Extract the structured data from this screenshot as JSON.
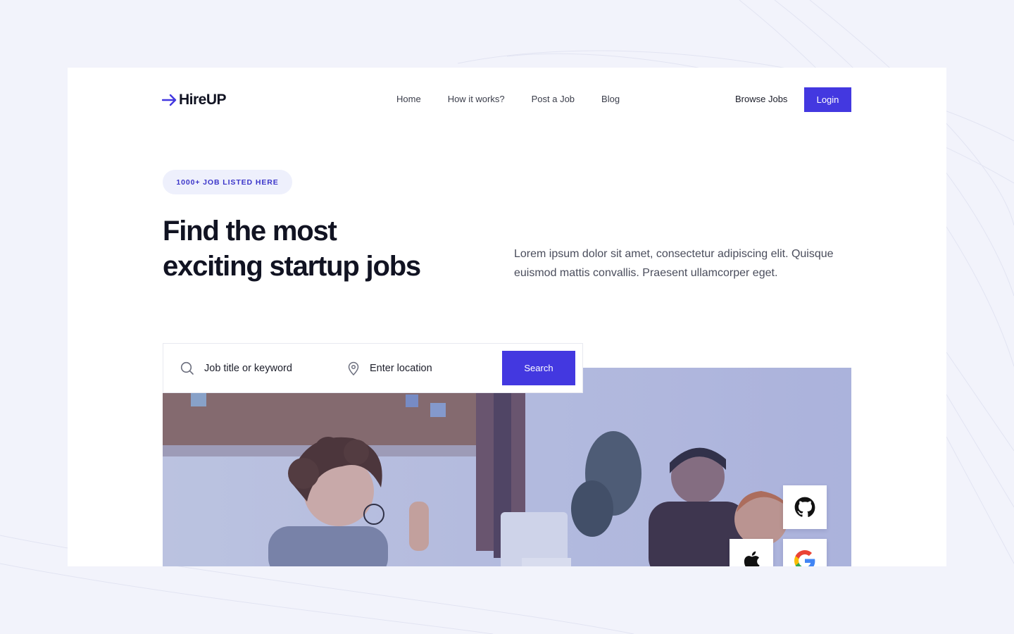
{
  "brand": {
    "name": "HireUP",
    "accent": "#4338e0"
  },
  "nav": {
    "items": [
      "Home",
      "How it works?",
      "Post a Job",
      "Blog"
    ]
  },
  "header": {
    "browse_label": "Browse Jobs",
    "login_label": "Login"
  },
  "hero": {
    "badge": "1000+ JOB LISTED HERE",
    "headline_line1": "Find the most",
    "headline_line2": "exciting startup jobs",
    "description_line1": "Lorem ipsum dolor sit amet, consectetur adipiscing elit. Quisque",
    "description_line2": "euismod mattis convallis. Praesent ullamcorper eget."
  },
  "search": {
    "keyword_placeholder": "Job title or keyword",
    "location_placeholder": "Enter location",
    "button_label": "Search"
  },
  "company_logos": [
    "github-icon",
    "apple-icon",
    "google-icon"
  ],
  "icons": {
    "search": "search-icon",
    "location": "location-pin-icon",
    "logo_arrow": "arrow-right-icon"
  }
}
